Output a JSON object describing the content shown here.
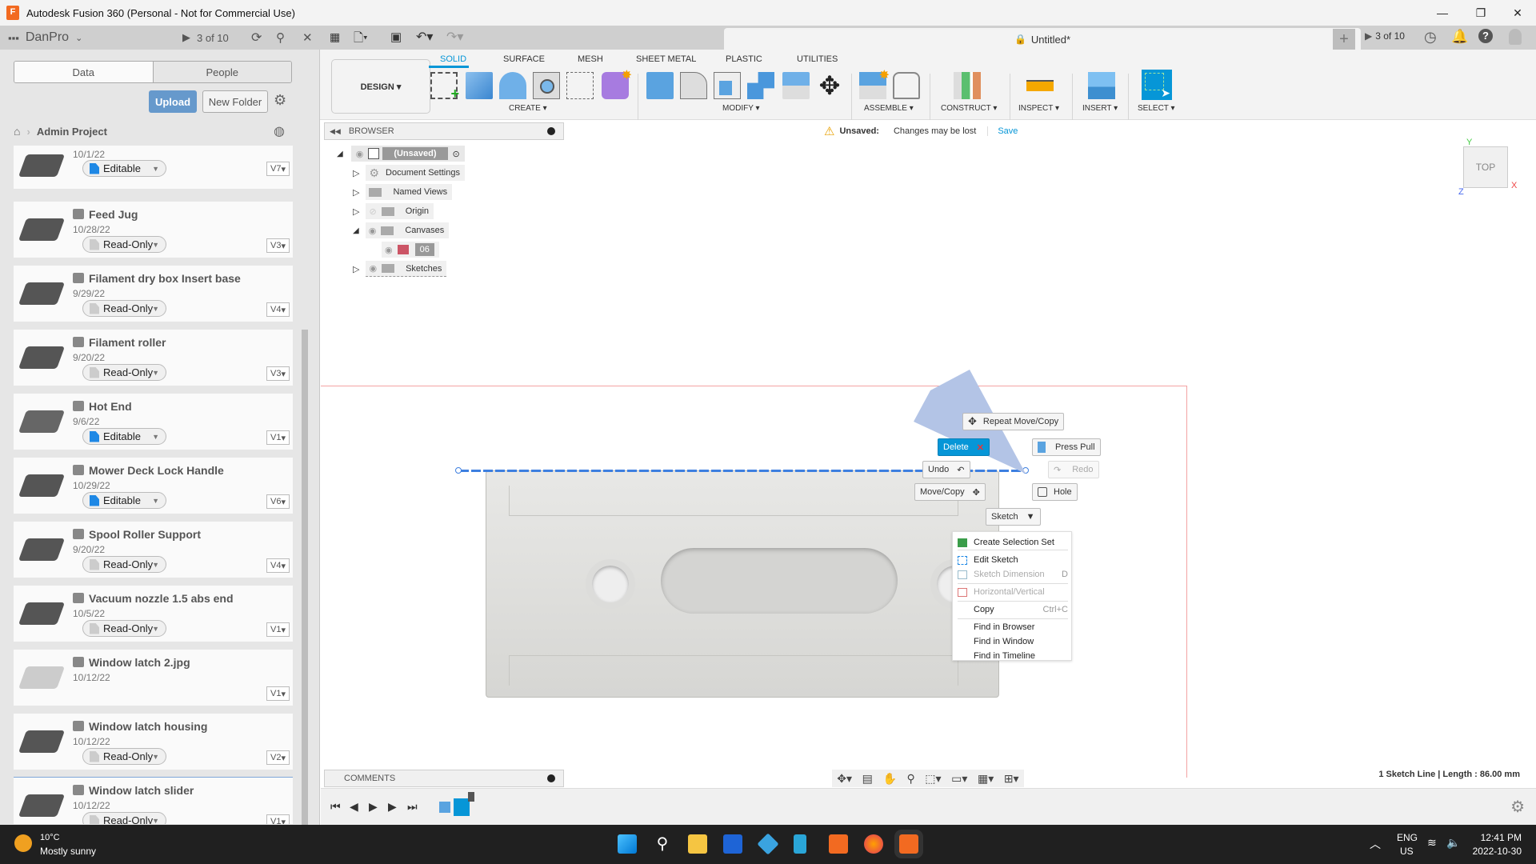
{
  "window": {
    "title": "Autodesk Fusion 360 (Personal - Not for Commercial Use)",
    "app_icon_letter": "F",
    "minimize": "—",
    "maximize": "❐",
    "close": "✕"
  },
  "data_panel": {
    "team": "DanPro",
    "doc_count": "3 of 10",
    "tabs": [
      "Data",
      "People"
    ],
    "upload": "Upload",
    "new_folder": "New Folder",
    "breadcrumb": "Admin Project",
    "files": [
      {
        "name": "",
        "date": "10/1/22",
        "permission": "Editable",
        "version": "V7",
        "editable": true
      },
      {
        "name": "Feed Jug",
        "date": "10/28/22",
        "permission": "Read-Only",
        "version": "V3",
        "editable": false
      },
      {
        "name": "Filament dry box Insert base",
        "date": "9/29/22",
        "permission": "Read-Only",
        "version": "V4",
        "editable": false
      },
      {
        "name": "Filament roller",
        "date": "9/20/22",
        "permission": "Read-Only",
        "version": "V3",
        "editable": false
      },
      {
        "name": "Hot End",
        "date": "9/6/22",
        "permission": "Editable",
        "version": "V1",
        "editable": true
      },
      {
        "name": "Mower Deck Lock Handle",
        "date": "10/29/22",
        "permission": "Editable",
        "version": "V6",
        "editable": true
      },
      {
        "name": "Spool Roller Support",
        "date": "9/20/22",
        "permission": "Read-Only",
        "version": "V4",
        "editable": false
      },
      {
        "name": "Vacuum nozzle 1.5 abs end",
        "date": "10/5/22",
        "permission": "Read-Only",
        "version": "V1",
        "editable": false
      },
      {
        "name": "Window latch 2.jpg",
        "date": "10/12/22",
        "permission": "",
        "version": "V1",
        "editable": false
      },
      {
        "name": "Window latch housing",
        "date": "10/12/22",
        "permission": "Read-Only",
        "version": "V2",
        "editable": false
      },
      {
        "name": "Window latch slider",
        "date": "10/12/22",
        "permission": "Read-Only",
        "version": "V1",
        "editable": false
      }
    ]
  },
  "document": {
    "title": "Untitled*",
    "doc_count": "3 of 10",
    "close": "✕",
    "new_tab": "+"
  },
  "ribbon": {
    "workspace": "DESIGN ▾",
    "tabs": [
      "SOLID",
      "SURFACE",
      "MESH",
      "SHEET METAL",
      "PLASTIC",
      "UTILITIES"
    ],
    "groups": [
      "CREATE ▾",
      "MODIFY ▾",
      "ASSEMBLE ▾",
      "CONSTRUCT ▾",
      "INSPECT ▾",
      "INSERT ▾",
      "SELECT ▾"
    ]
  },
  "browser": {
    "title": "BROWSER",
    "root": "(Unsaved)",
    "nodes": [
      "Document Settings",
      "Named Views",
      "Origin",
      "Canvases",
      "06",
      "Sketches"
    ]
  },
  "unsaved_bar": {
    "label": "Unsaved:",
    "message": "Changes may be lost",
    "save": "Save"
  },
  "viewcube": {
    "face": "TOP",
    "x": "X",
    "y": "Y",
    "z": "Z"
  },
  "marking_menu": {
    "repeat": "Repeat Move/Copy",
    "delete": "Delete",
    "press_pull": "Press Pull",
    "undo": "Undo",
    "redo": "Redo",
    "move_copy": "Move/Copy",
    "hole": "Hole",
    "sketch": "Sketch"
  },
  "context_menu": {
    "items": [
      {
        "label": "Create Selection Set",
        "shortcut": "",
        "disabled": false
      },
      {
        "label": "Edit Sketch",
        "shortcut": "",
        "disabled": false
      },
      {
        "label": "Sketch Dimension",
        "shortcut": "D",
        "disabled": true
      },
      {
        "label": "Horizontal/Vertical",
        "shortcut": "",
        "disabled": true
      },
      {
        "label": "Copy",
        "shortcut": "Ctrl+C",
        "disabled": false
      },
      {
        "label": "Find in Browser",
        "shortcut": "",
        "disabled": false
      },
      {
        "label": "Find in Window",
        "shortcut": "",
        "disabled": false
      },
      {
        "label": "Find in Timeline",
        "shortcut": "",
        "disabled": false
      }
    ]
  },
  "comments": {
    "label": "COMMENTS"
  },
  "status": {
    "selection": "1 Sketch Line | Length : 86.00 mm"
  },
  "taskbar": {
    "temp": "10°C",
    "weather": "Mostly sunny",
    "lang1": "ENG",
    "lang2": "US",
    "time": "12:41 PM",
    "date": "2022-10-30"
  },
  "colors": {
    "accent": "#0696d7",
    "upload": "#6699cc",
    "sketch_line": "#3d7fe0"
  }
}
